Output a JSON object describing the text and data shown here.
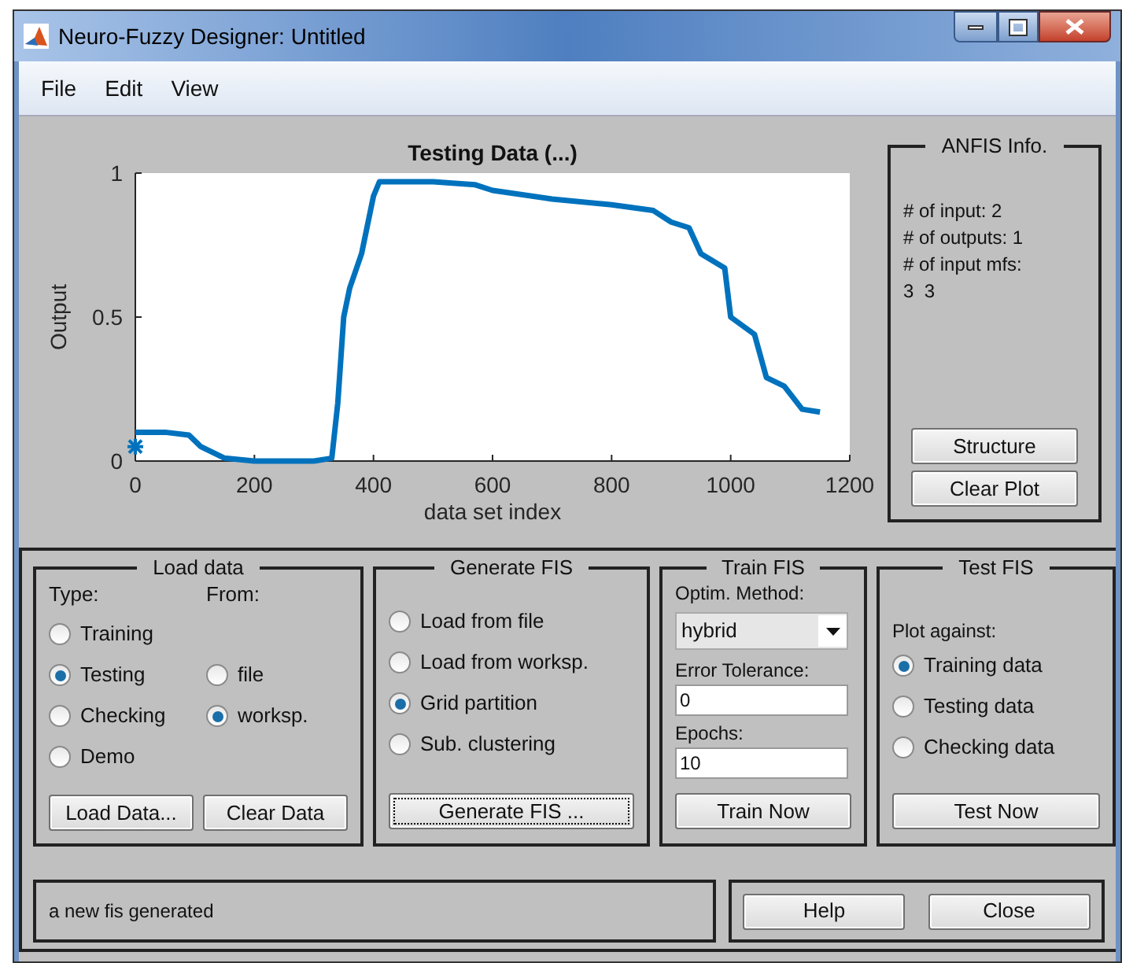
{
  "window": {
    "title": "Neuro-Fuzzy Designer: Untitled"
  },
  "menu": [
    "File",
    "Edit",
    "View"
  ],
  "plot": {
    "chart_data": {
      "type": "line",
      "title": "Testing Data (...)",
      "xlabel": "data set index",
      "ylabel": "Output",
      "x": [
        0,
        50,
        90,
        110,
        150,
        200,
        250,
        300,
        330,
        340,
        350,
        360,
        380,
        400,
        410,
        500,
        570,
        600,
        700,
        800,
        870,
        900,
        930,
        950,
        990,
        1000,
        1040,
        1060,
        1090,
        1120,
        1150
      ],
      "series": [
        {
          "color": "#0072bd",
          "values": [
            0.1,
            0.1,
            0.09,
            0.05,
            0.01,
            0.0,
            0.0,
            0.0,
            0.01,
            0.2,
            0.5,
            0.6,
            0.72,
            0.92,
            0.97,
            0.97,
            0.96,
            0.94,
            0.91,
            0.89,
            0.87,
            0.83,
            0.81,
            0.72,
            0.67,
            0.5,
            0.44,
            0.29,
            0.26,
            0.18,
            0.17
          ]
        },
        {
          "color": "#0072bd",
          "marker": "cross",
          "values": [
            0.05,
            null,
            null,
            null,
            null,
            null,
            null,
            null,
            null,
            null,
            null,
            null,
            null,
            null,
            null,
            null,
            null,
            null,
            null,
            null,
            null,
            null,
            null,
            null,
            null,
            null,
            null,
            null,
            null,
            null,
            null
          ]
        }
      ],
      "xlim": [
        0,
        1200
      ],
      "ylim": [
        0,
        1
      ],
      "xticks": [
        0,
        200,
        400,
        600,
        800,
        1000,
        1200
      ],
      "yticks": [
        0,
        0.5,
        1
      ]
    }
  },
  "anfis_info": {
    "title": "ANFIS Info.",
    "lines": [
      "# of input: 2",
      "# of outputs: 1",
      "# of input mfs:",
      "3  3"
    ],
    "buttons": [
      "Structure",
      "Clear Plot"
    ]
  },
  "load_data": {
    "title": "Load data",
    "type_label": "Type:",
    "from_label": "From:",
    "types": [
      {
        "label": "Training",
        "selected": false
      },
      {
        "label": "Testing",
        "selected": true
      },
      {
        "label": "Checking",
        "selected": false
      },
      {
        "label": "Demo",
        "selected": false
      }
    ],
    "sources": [
      {
        "label": "file",
        "selected": false
      },
      {
        "label": "worksp.",
        "selected": true
      }
    ],
    "buttons": [
      "Load Data...",
      "Clear Data"
    ]
  },
  "generate_fis": {
    "title": "Generate FIS",
    "options": [
      {
        "label": "Load from file",
        "selected": false
      },
      {
        "label": "Load from worksp.",
        "selected": false
      },
      {
        "label": "Grid partition",
        "selected": true
      },
      {
        "label": "Sub. clustering",
        "selected": false
      }
    ],
    "button": "Generate FIS ..."
  },
  "train_fis": {
    "title": "Train FIS",
    "method_label": "Optim. Method:",
    "method": "hybrid",
    "tolerance_label": "Error Tolerance:",
    "tolerance": "0",
    "epochs_label": "Epochs:",
    "epochs": "10",
    "button": "Train Now"
  },
  "test_fis": {
    "title": "Test FIS",
    "plot_label": "Plot against:",
    "options": [
      {
        "label": "Training data",
        "selected": true
      },
      {
        "label": "Testing data",
        "selected": false
      },
      {
        "label": "Checking data",
        "selected": false
      }
    ],
    "button": "Test Now"
  },
  "status": "a new fis generated",
  "buttons": [
    "Help",
    "Close"
  ]
}
